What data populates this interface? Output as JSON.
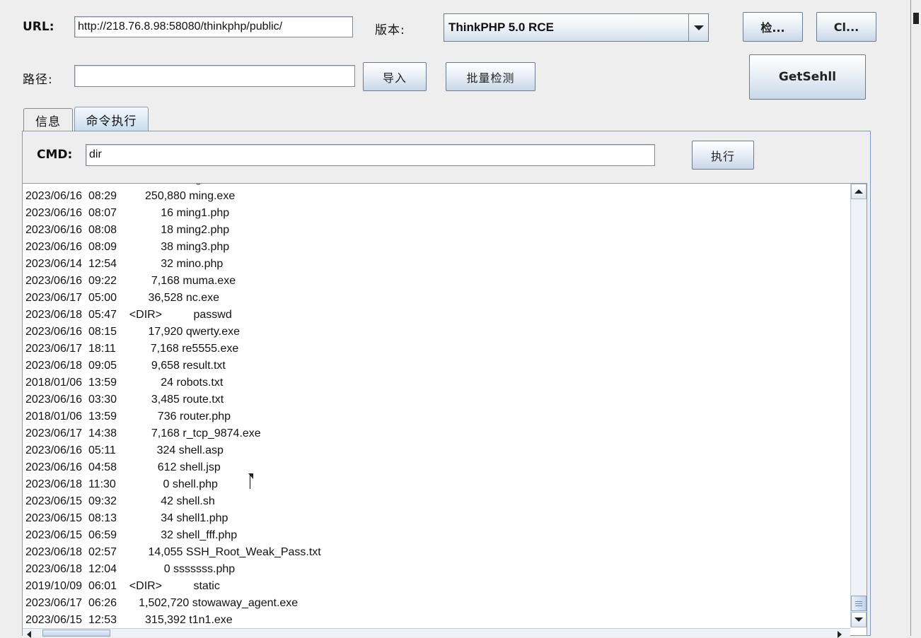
{
  "top": {
    "url_label": "URL:",
    "url_value": "http://218.76.8.98:58080/thinkphp/public/",
    "version_label": "版本:",
    "version_selected": "ThinkPHP 5.0 RCE",
    "check_button": "检...",
    "clear_button": "Cl...",
    "path_label": "路径:",
    "path_value": "",
    "import_button": "导入",
    "batch_button": "批量检测",
    "getshell_button": "GetSehll"
  },
  "tabs": [
    {
      "label": "信息"
    },
    {
      "label": "命令执行"
    }
  ],
  "cmd": {
    "label": "CMD:",
    "value": "dir",
    "execute_button": "执行"
  },
  "output": {
    "lines": [
      "2023/06/16  08:29         250,880 ming.exe",
      "2023/06/16  08:07              16 ming1.php",
      "2023/06/16  08:08              18 ming2.php",
      "2023/06/16  08:09              38 ming3.php",
      "2023/06/14  12:54              32 mino.php",
      "2023/06/16  09:22           7,168 muma.exe",
      "2023/06/17  05:00          36,528 nc.exe",
      "2023/06/18  05:47    <DIR>          passwd",
      "2023/06/16  08:15          17,920 qwerty.exe",
      "2023/06/17  18:11           7,168 re5555.exe",
      "2023/06/18  09:05           9,658 result.txt",
      "2018/01/06  13:59              24 robots.txt",
      "2023/06/16  03:30           3,485 route.txt",
      "2018/01/06  13:59             736 router.php",
      "2023/06/17  14:38           7,168 r_tcp_9874.exe",
      "2023/06/16  05:11             324 shell.asp",
      "2023/06/16  04:58             612 shell.jsp",
      "2023/06/18  11:30               0 shell.php",
      "2023/06/15  09:32              42 shell.sh",
      "2023/06/15  08:13              34 shell1.php",
      "2023/06/15  06:59              32 shell_fff.php",
      "2023/06/18  02:57          14,055 SSH_Root_Weak_Pass.txt",
      "2023/06/18  12:04               0 sssssss.php",
      "2019/10/09  06:01    <DIR>          static",
      "2023/06/17  06:26       1,502,720 stowaway_agent.exe",
      "2023/06/15  12:53         315,392 t1n1.exe"
    ]
  }
}
